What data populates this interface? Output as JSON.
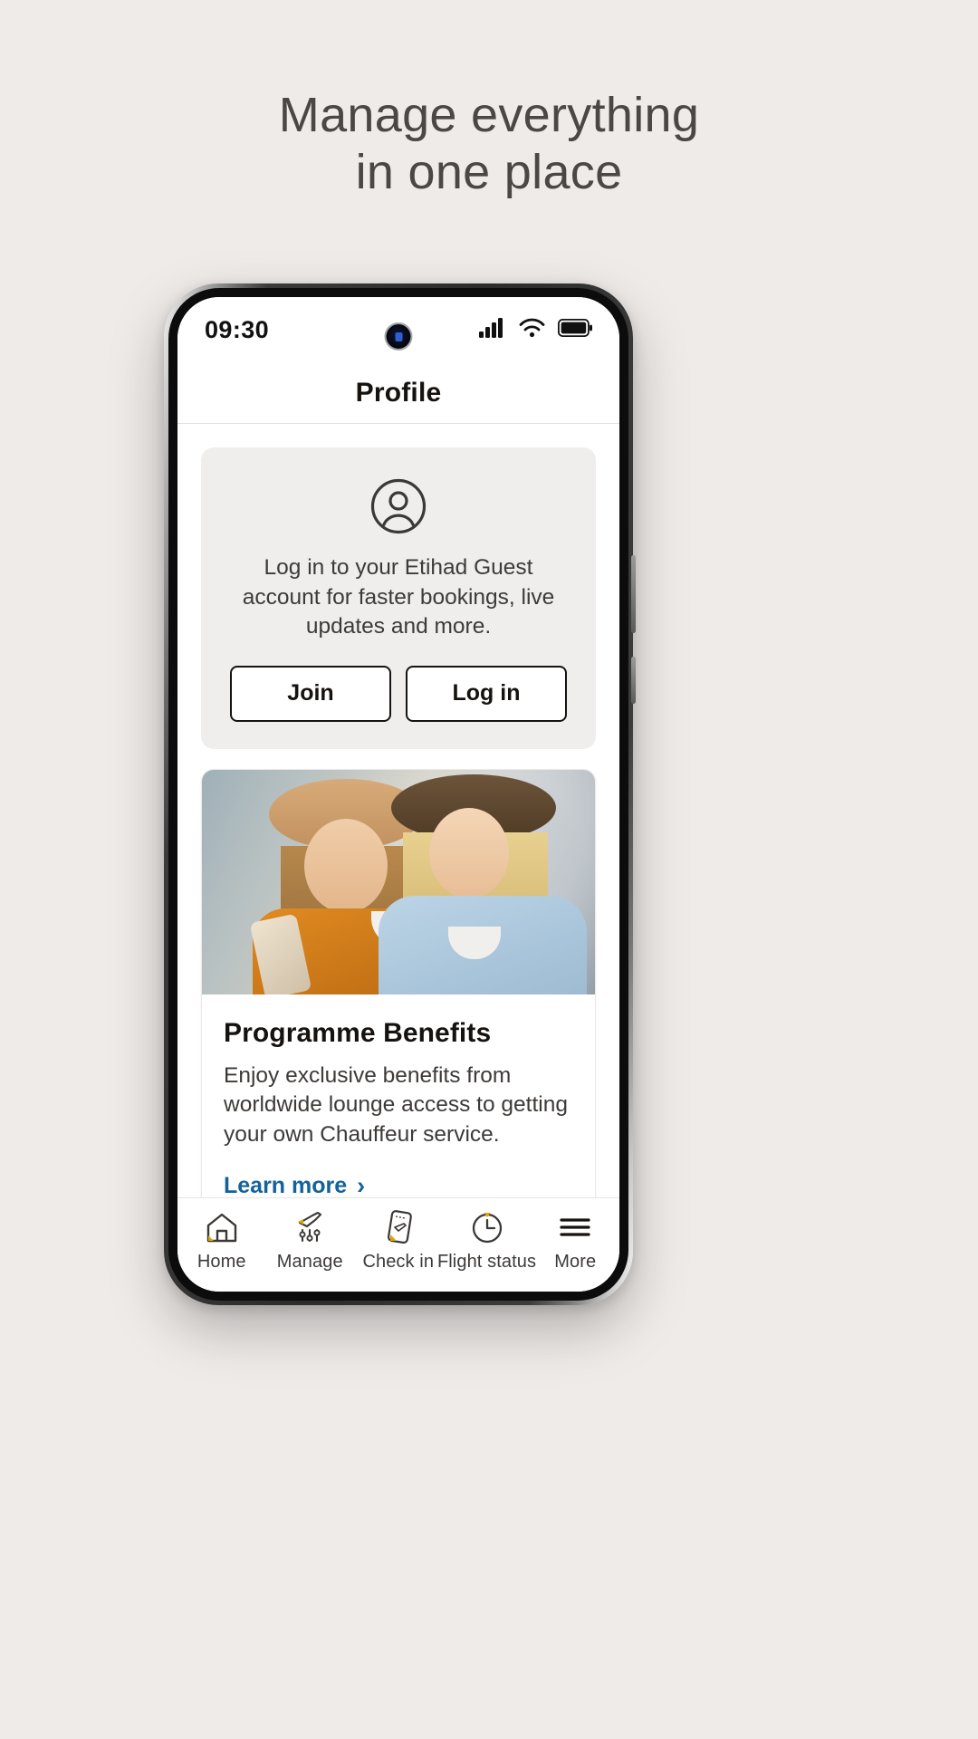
{
  "promo": {
    "line1": "Manage everything",
    "line2": "in one place"
  },
  "phone": {
    "status": {
      "time": "09:30",
      "icons": [
        "signal-icon",
        "wifi-icon",
        "battery-icon"
      ],
      "battery_level": "full"
    },
    "header": {
      "title": "Profile"
    },
    "login_card": {
      "avatar_icon": "user-avatar-icon",
      "message": "Log in to your Etihad Guest account for faster bookings, live updates and more.",
      "join_label": "Join",
      "login_label": "Log in"
    },
    "benefit_card": {
      "image_alt": "two-women-with-coffee",
      "title": "Programme Benefits",
      "description": "Enjoy exclusive benefits from worldwide lounge access to getting your own Chauffeur service.",
      "link_label": "Learn more",
      "link_chevron": "›",
      "link_color": "#14629a"
    },
    "carousel": {
      "total": 4,
      "active_index": 0,
      "active_color": "#242063",
      "inactive_color": "#dcdad8"
    },
    "bottom_nav": {
      "items": [
        {
          "label": "Home",
          "icon": "home-icon"
        },
        {
          "label": "Manage",
          "icon": "plane-sliders-icon"
        },
        {
          "label": "Check in",
          "icon": "boarding-pass-icon"
        },
        {
          "label": "Flight status",
          "icon": "clock-icon"
        },
        {
          "label": "More",
          "icon": "hamburger-menu-icon"
        }
      ],
      "accent_color": "#e0a400"
    }
  },
  "theme": {
    "page_background": "#efebe9",
    "heading_color": "#4a4745",
    "text_color": "#3d3a38"
  }
}
